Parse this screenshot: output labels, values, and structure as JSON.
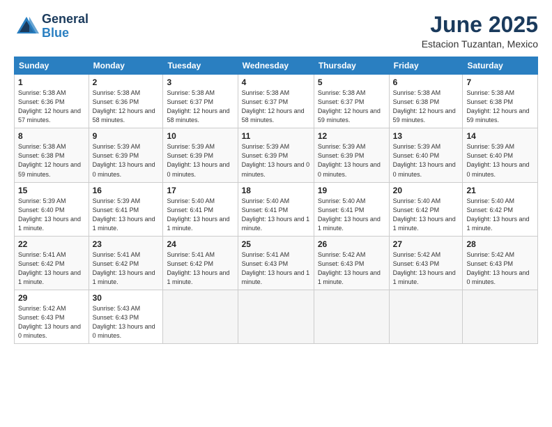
{
  "header": {
    "logo_line1": "General",
    "logo_line2": "Blue",
    "month": "June 2025",
    "location": "Estacion Tuzantan, Mexico"
  },
  "weekdays": [
    "Sunday",
    "Monday",
    "Tuesday",
    "Wednesday",
    "Thursday",
    "Friday",
    "Saturday"
  ],
  "weeks": [
    [
      {
        "day": "1",
        "sunrise": "5:38 AM",
        "sunset": "6:36 PM",
        "daylight": "12 hours and 57 minutes."
      },
      {
        "day": "2",
        "sunrise": "5:38 AM",
        "sunset": "6:36 PM",
        "daylight": "12 hours and 58 minutes."
      },
      {
        "day": "3",
        "sunrise": "5:38 AM",
        "sunset": "6:37 PM",
        "daylight": "12 hours and 58 minutes."
      },
      {
        "day": "4",
        "sunrise": "5:38 AM",
        "sunset": "6:37 PM",
        "daylight": "12 hours and 58 minutes."
      },
      {
        "day": "5",
        "sunrise": "5:38 AM",
        "sunset": "6:37 PM",
        "daylight": "12 hours and 59 minutes."
      },
      {
        "day": "6",
        "sunrise": "5:38 AM",
        "sunset": "6:38 PM",
        "daylight": "12 hours and 59 minutes."
      },
      {
        "day": "7",
        "sunrise": "5:38 AM",
        "sunset": "6:38 PM",
        "daylight": "12 hours and 59 minutes."
      }
    ],
    [
      {
        "day": "8",
        "sunrise": "5:38 AM",
        "sunset": "6:38 PM",
        "daylight": "12 hours and 59 minutes."
      },
      {
        "day": "9",
        "sunrise": "5:39 AM",
        "sunset": "6:39 PM",
        "daylight": "13 hours and 0 minutes."
      },
      {
        "day": "10",
        "sunrise": "5:39 AM",
        "sunset": "6:39 PM",
        "daylight": "13 hours and 0 minutes."
      },
      {
        "day": "11",
        "sunrise": "5:39 AM",
        "sunset": "6:39 PM",
        "daylight": "13 hours and 0 minutes."
      },
      {
        "day": "12",
        "sunrise": "5:39 AM",
        "sunset": "6:39 PM",
        "daylight": "13 hours and 0 minutes."
      },
      {
        "day": "13",
        "sunrise": "5:39 AM",
        "sunset": "6:40 PM",
        "daylight": "13 hours and 0 minutes."
      },
      {
        "day": "14",
        "sunrise": "5:39 AM",
        "sunset": "6:40 PM",
        "daylight": "13 hours and 0 minutes."
      }
    ],
    [
      {
        "day": "15",
        "sunrise": "5:39 AM",
        "sunset": "6:40 PM",
        "daylight": "13 hours and 1 minute."
      },
      {
        "day": "16",
        "sunrise": "5:39 AM",
        "sunset": "6:41 PM",
        "daylight": "13 hours and 1 minute."
      },
      {
        "day": "17",
        "sunrise": "5:40 AM",
        "sunset": "6:41 PM",
        "daylight": "13 hours and 1 minute."
      },
      {
        "day": "18",
        "sunrise": "5:40 AM",
        "sunset": "6:41 PM",
        "daylight": "13 hours and 1 minute."
      },
      {
        "day": "19",
        "sunrise": "5:40 AM",
        "sunset": "6:41 PM",
        "daylight": "13 hours and 1 minute."
      },
      {
        "day": "20",
        "sunrise": "5:40 AM",
        "sunset": "6:42 PM",
        "daylight": "13 hours and 1 minute."
      },
      {
        "day": "21",
        "sunrise": "5:40 AM",
        "sunset": "6:42 PM",
        "daylight": "13 hours and 1 minute."
      }
    ],
    [
      {
        "day": "22",
        "sunrise": "5:41 AM",
        "sunset": "6:42 PM",
        "daylight": "13 hours and 1 minute."
      },
      {
        "day": "23",
        "sunrise": "5:41 AM",
        "sunset": "6:42 PM",
        "daylight": "13 hours and 1 minute."
      },
      {
        "day": "24",
        "sunrise": "5:41 AM",
        "sunset": "6:42 PM",
        "daylight": "13 hours and 1 minute."
      },
      {
        "day": "25",
        "sunrise": "5:41 AM",
        "sunset": "6:43 PM",
        "daylight": "13 hours and 1 minute."
      },
      {
        "day": "26",
        "sunrise": "5:42 AM",
        "sunset": "6:43 PM",
        "daylight": "13 hours and 1 minute."
      },
      {
        "day": "27",
        "sunrise": "5:42 AM",
        "sunset": "6:43 PM",
        "daylight": "13 hours and 1 minute."
      },
      {
        "day": "28",
        "sunrise": "5:42 AM",
        "sunset": "6:43 PM",
        "daylight": "13 hours and 0 minutes."
      }
    ],
    [
      {
        "day": "29",
        "sunrise": "5:42 AM",
        "sunset": "6:43 PM",
        "daylight": "13 hours and 0 minutes."
      },
      {
        "day": "30",
        "sunrise": "5:43 AM",
        "sunset": "6:43 PM",
        "daylight": "13 hours and 0 minutes."
      },
      null,
      null,
      null,
      null,
      null
    ]
  ]
}
